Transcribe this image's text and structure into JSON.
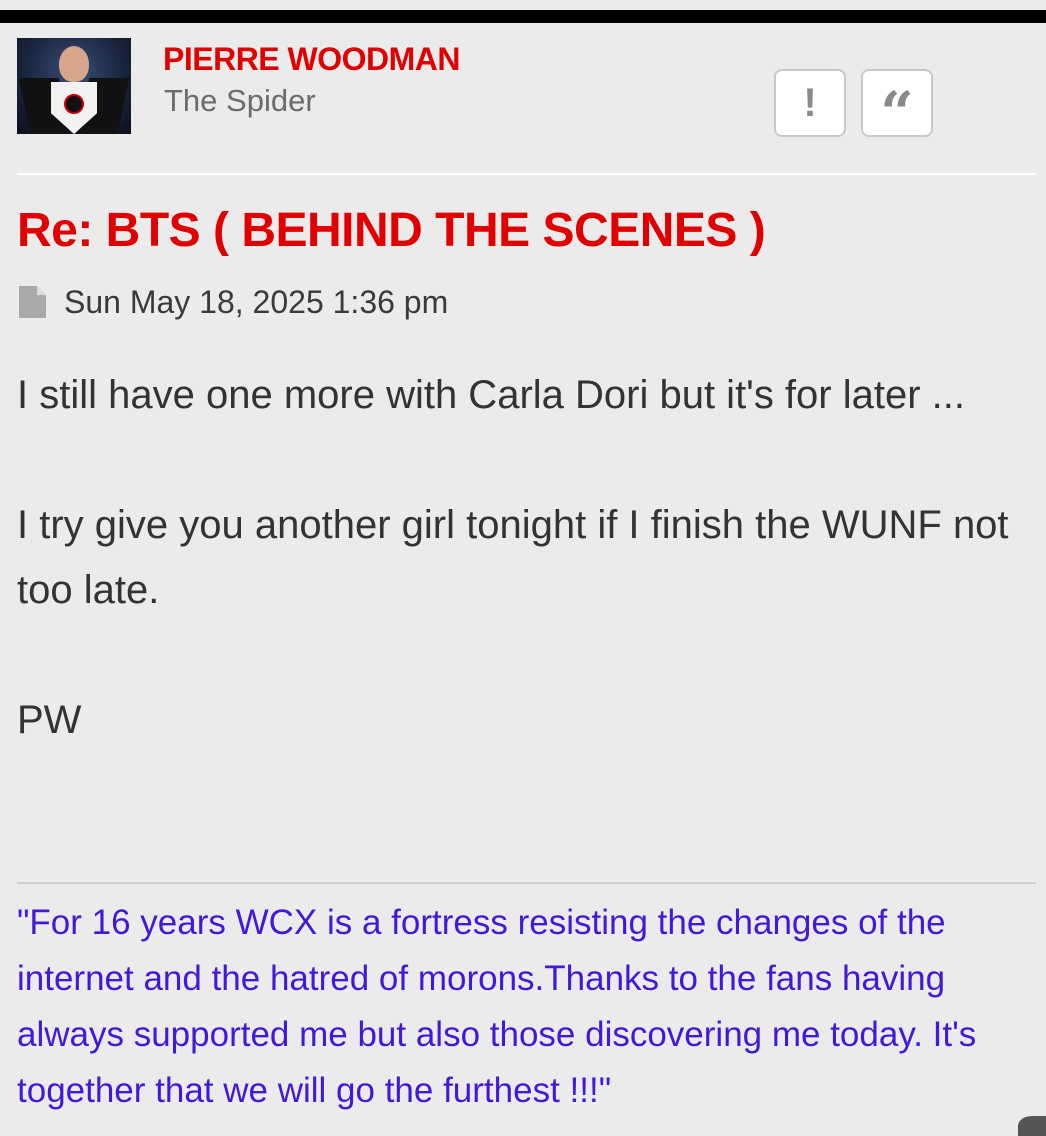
{
  "author": {
    "name": "PIERRE WOODMAN",
    "rank": "The Spider"
  },
  "actions": {
    "report_glyph": "!",
    "quote_glyph": "“"
  },
  "post": {
    "title": "Re: BTS ( BEHIND THE SCENES )",
    "date": "Sun May 18, 2025 1:36 pm",
    "paragraphs": [
      "I still have one more with Carla Dori but it's for later ...",
      "I try give you another girl tonight if I finish the WUNF not too late.",
      "PW"
    ]
  },
  "signature": "\"For 16 years WCX is a fortress resisting the changes of the internet and the hatred of morons.Thanks to the fans having always supported me but also those discovering me today. It's together that we will go the furthest !!!\"",
  "colors": {
    "accent_red": "#e00000",
    "signature_purple": "#4418d8",
    "background": "#ebebeb"
  },
  "icons": [
    "report-icon",
    "quote-icon",
    "file-icon",
    "avatar-image"
  ]
}
